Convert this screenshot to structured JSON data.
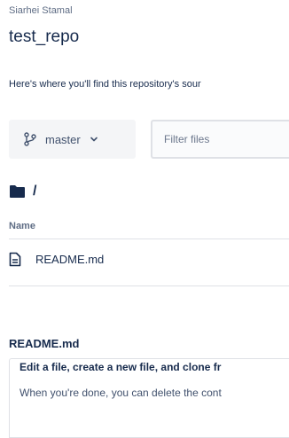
{
  "repo": {
    "owner": "Siarhei Stamal",
    "name": "test_repo",
    "description": "Here's where you'll find this repository's sour"
  },
  "toolbar": {
    "branch_label": "master",
    "branch_icon": "branch-icon",
    "filter_placeholder": "Filter files"
  },
  "path": {
    "folder_icon": "folder-icon",
    "text": "/"
  },
  "file_table": {
    "column_header": "Name",
    "rows": [
      {
        "icon": "file-icon",
        "name": "README.md"
      }
    ]
  },
  "readme": {
    "heading": "README.md",
    "section_title": "Edit a file, create a new file, and clone fr",
    "section_text": "When you're done, you can delete the cont"
  },
  "colors": {
    "text_primary": "#172b4d",
    "text_secondary": "#5e6c84",
    "button_bg": "#f4f5f7",
    "border": "#dfe1e6"
  }
}
